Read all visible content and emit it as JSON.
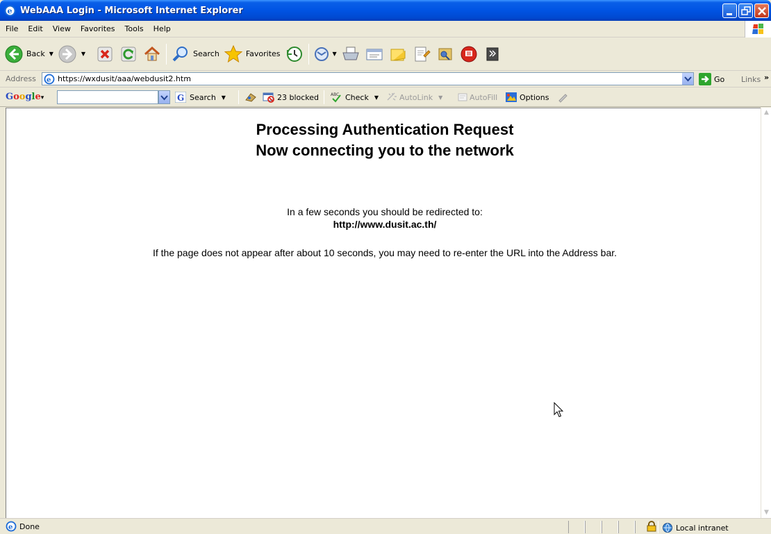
{
  "window": {
    "title": "WebAAA Login - Microsoft Internet Explorer"
  },
  "menu": [
    "File",
    "Edit",
    "View",
    "Favorites",
    "Tools",
    "Help"
  ],
  "toolbar": {
    "back_label": "Back",
    "search_label": "Search",
    "favorites_label": "Favorites"
  },
  "address": {
    "label": "Address",
    "url": "https://wxdusit/aaa/webdusit2.htm",
    "go_label": "Go",
    "links_label": "Links"
  },
  "google": {
    "logo": [
      "G",
      "o",
      "o",
      "g",
      "l",
      "e"
    ],
    "logo_suffix": "▾",
    "search_label": "Search",
    "blocked_label": "23 blocked",
    "check_label": "Check",
    "autolink_label": "AutoLink",
    "autofill_label": "AutoFill",
    "options_label": "Options"
  },
  "page": {
    "heading1": "Processing Authentication Request",
    "heading2": "Now connecting you to the network",
    "redirect_text": "In a few seconds you should be redirected to:",
    "redirect_url": "http://www.dusit.ac.th/",
    "notice": "If the page does not appear after about 10 seconds, you may need to re-enter the URL into the Address bar."
  },
  "status": {
    "text": "Done",
    "zone": "Local intranet"
  },
  "icons": {
    "back": "back-arrow-icon",
    "forward": "forward-arrow-icon",
    "stop": "stop-icon",
    "refresh": "refresh-icon",
    "home": "home-icon",
    "search": "search-icon",
    "favorites": "favorites-star-icon",
    "history": "history-icon",
    "mail": "mail-icon",
    "print": "print-icon",
    "edit": "edit-icon",
    "folder": "folder-icon",
    "research": "research-icon",
    "messenger": "messenger-icon",
    "lock": "lock-icon",
    "intranet": "intranet-icon"
  }
}
